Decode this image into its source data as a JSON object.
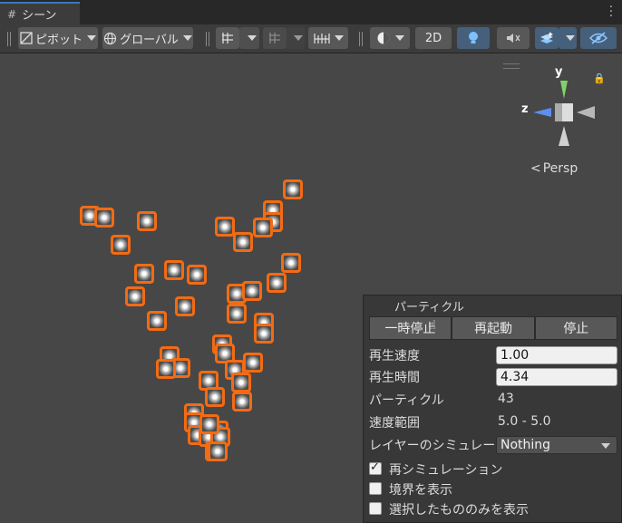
{
  "tab": {
    "icon": "grid-icon",
    "title": "シーン"
  },
  "toolbar": {
    "pivot_label": "ピボット",
    "global_label": "グローバル",
    "mode_2d": "2D"
  },
  "gizmo": {
    "y": "y",
    "z": "z",
    "persp": "Persp"
  },
  "particle_panel": {
    "title": "パーティクル",
    "pause": "一時停止",
    "restart": "再起動",
    "stop": "停止",
    "playback_speed_label": "再生速度",
    "playback_speed": "1.00",
    "playback_time_label": "再生時間",
    "playback_time": "4.34",
    "particles_label": "パーティクル",
    "particles": "43",
    "speed_range_label": "速度範囲",
    "speed_range": "5.0 - 5.0",
    "layer_sim_label": "レイヤーのシミュレーション",
    "layer_sim_value": "Nothing",
    "resimulate_label": "再シミュレーション",
    "resimulate": true,
    "show_bounds_label": "境界を表示",
    "show_bounds": false,
    "show_selected_label": "選択したもののみを表示",
    "show_selected": false
  },
  "colors": {
    "selection_outline": "#f36b13",
    "accent": "#3a79bb"
  }
}
